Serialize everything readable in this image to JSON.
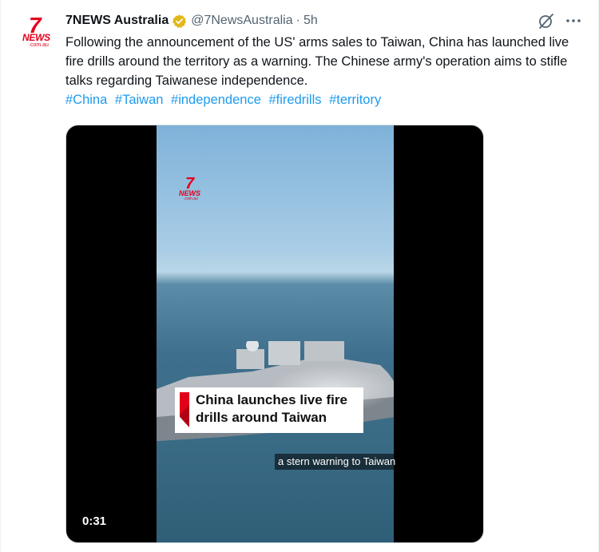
{
  "author": {
    "display_name": "7NEWS Australia",
    "handle": "@7NewsAustralia",
    "time_ago": "5h",
    "separator": "·",
    "avatar": {
      "seven": "7",
      "news": "NEWS",
      "sub": ".com.au"
    },
    "verified_badge_color": "#e2b719"
  },
  "tweet": {
    "text": "Following the announcement of the US' arms sales to Taiwan, China has launched live fire drills around the territory as a warning. The Chinese army's operation aims to stifle talks regarding Taiwanese independence.",
    "hashtags": [
      "#China",
      "#Taiwan",
      "#independence",
      "#firedrills",
      "#territory"
    ]
  },
  "media": {
    "logo": {
      "seven": "7",
      "news": "NEWS",
      "sub": ".com.au"
    },
    "headline": "China launches live fire drills around Taiwan",
    "subtitle": "a stern warning to Taiwan",
    "duration": "0:31"
  },
  "icons": {
    "grok": "grok-icon",
    "more": "more-icon",
    "verified": "verified-badge-icon"
  },
  "colors": {
    "link": "#1d9bf0",
    "secondary_text": "#536471",
    "brand_red": "#e3001b"
  }
}
